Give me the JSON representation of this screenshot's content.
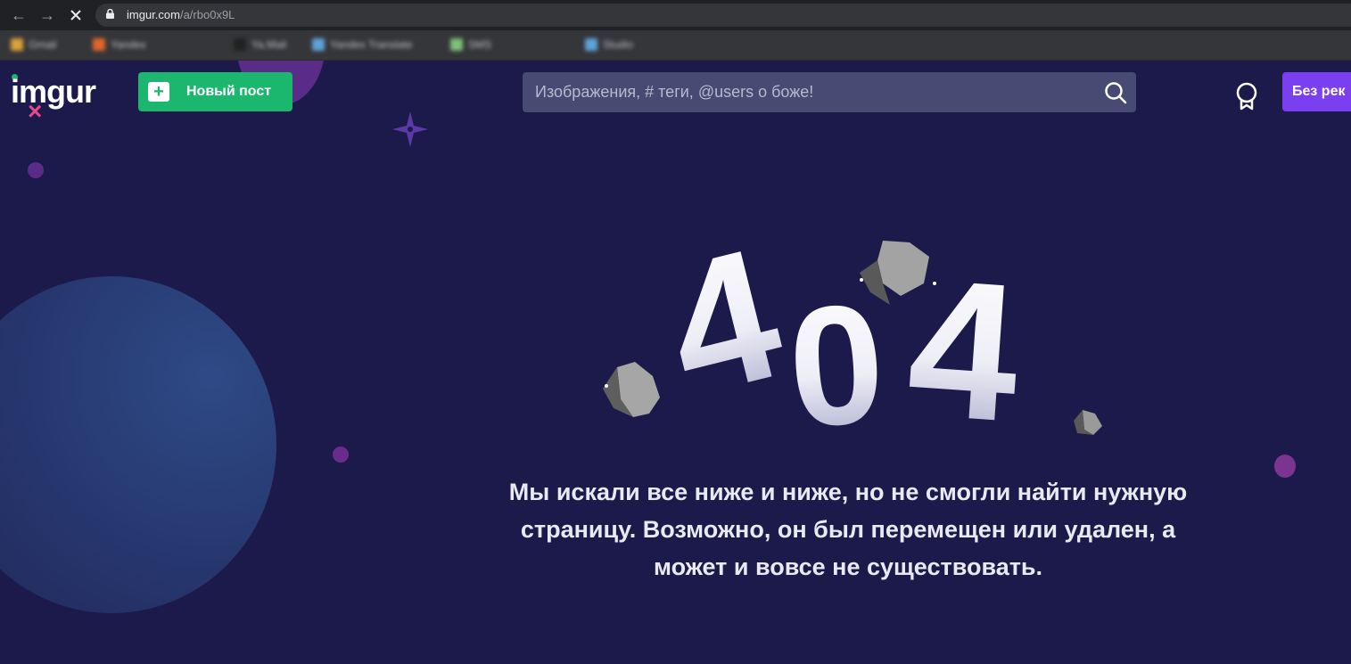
{
  "browser": {
    "url_host": "imgur.com",
    "url_path": "/a/rbo0x9L",
    "bookmarks": [
      "Gmail",
      "Yandex",
      "Ya.Mail",
      "Yandex Translate",
      "SMS",
      "Studio"
    ]
  },
  "header": {
    "logo": "imgur",
    "new_post_label": "Новый пост",
    "search_placeholder": "Изображения, # теги, @users о боже!",
    "no_ads_label": "Без рек"
  },
  "error": {
    "code_digits": [
      "4",
      "0",
      "4"
    ],
    "message": "Мы искали все ниже и ниже, но не смогли найти нужную страницу. Возможно, он был перемещен или удален, а может и вовсе не существовать."
  },
  "colors": {
    "background": "#1b1a4a",
    "new_post": "#1bb76e",
    "no_ads": "#7b3ff2",
    "search": "#474a72"
  }
}
